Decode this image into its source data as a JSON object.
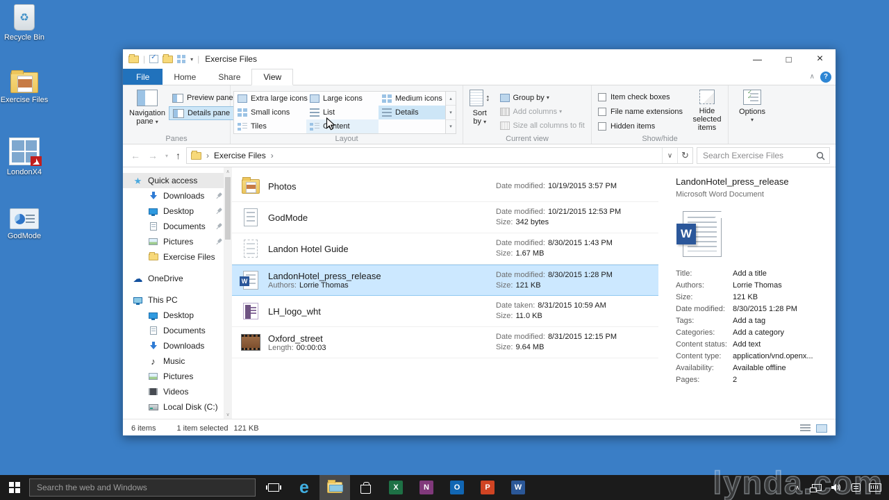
{
  "colors": {
    "desktop": "#3a7ec6",
    "accent": "#2172bc",
    "selection": "#cce8ff",
    "taskbar": "#1b1b1b"
  },
  "glyphs": {
    "minimize": "—",
    "maximize": "□",
    "close": "×",
    "back": "←",
    "forward": "→",
    "up": "↑",
    "refresh": "↻",
    "dropdown": "▾",
    "collapse": "∧",
    "help": "?",
    "crumb_sep": "›",
    "scroll_up": "▴",
    "scroll_down": "▾",
    "star": "★",
    "cloud": "☁",
    "music_note": "♪",
    "recycle": "♻",
    "updown": "↕",
    "chevron_down": "∨",
    "chevron_up": "∧"
  },
  "desktop_icons": [
    {
      "label": "Recycle Bin"
    },
    {
      "label": "Exercise Files"
    },
    {
      "label": "LondonX4"
    },
    {
      "label": "GodMode"
    }
  ],
  "watermark": "lynda.com",
  "titlebar": {
    "title": "Exercise Files"
  },
  "tabs": {
    "file": "File",
    "home": "Home",
    "share": "Share",
    "view": "View"
  },
  "ribbon": {
    "panes": {
      "group_label": "Panes",
      "navigation_pane_line1": "Navigation",
      "navigation_pane_line2": "pane",
      "preview_pane": "Preview pane",
      "details_pane": "Details pane"
    },
    "layout": {
      "group_label": "Layout",
      "extra_large": "Extra large icons",
      "small": "Small icons",
      "tiles": "Tiles",
      "large": "Large icons",
      "list": "List",
      "content": "Content",
      "medium": "Medium icons",
      "details": "Details"
    },
    "current_view": {
      "group_label": "Current view",
      "sort_by_line1": "Sort",
      "sort_by_line2": "by",
      "group_by": "Group by",
      "add_columns": "Add columns",
      "size_all": "Size all columns to fit"
    },
    "show_hide": {
      "group_label": "Show/hide",
      "item_check_boxes": "Item check boxes",
      "file_name_extensions": "File name extensions",
      "hidden_items": "Hidden items",
      "hide_selected_line1": "Hide selected",
      "hide_selected_line2": "items"
    },
    "options": {
      "label": "Options"
    }
  },
  "addressbar": {
    "crumb": "Exercise Files",
    "search_placeholder": "Search Exercise Files"
  },
  "sidebar": {
    "items": [
      {
        "label": "Quick access"
      },
      {
        "label": "Downloads"
      },
      {
        "label": "Desktop"
      },
      {
        "label": "Documents"
      },
      {
        "label": "Pictures"
      },
      {
        "label": "Exercise Files"
      },
      {
        "label": "OneDrive"
      },
      {
        "label": "This PC"
      },
      {
        "label": "Desktop"
      },
      {
        "label": "Documents"
      },
      {
        "label": "Downloads"
      },
      {
        "label": "Music"
      },
      {
        "label": "Pictures"
      },
      {
        "label": "Videos"
      },
      {
        "label": "Local Disk (C:)"
      }
    ]
  },
  "files": [
    {
      "name": "Photos",
      "meta1_label": "Date modified:",
      "meta1_value": "10/19/2015 3:57 PM"
    },
    {
      "name": "GodMode",
      "meta1_label": "Date modified:",
      "meta1_value": "10/21/2015 12:53 PM",
      "meta2_label": "Size:",
      "meta2_value": "342 bytes"
    },
    {
      "name": "Landon Hotel Guide",
      "meta1_label": "Date modified:",
      "meta1_value": "8/30/2015 1:43 PM",
      "meta2_label": "Size:",
      "meta2_value": "1.67 MB"
    },
    {
      "name": "LandonHotel_press_release",
      "sub_label": "Authors:",
      "sub_value": "Lorrie  Thomas",
      "meta1_label": "Date modified:",
      "meta1_value": "8/30/2015 1:28 PM",
      "meta2_label": "Size:",
      "meta2_value": "121 KB"
    },
    {
      "name": "LH_logo_wht",
      "meta1_label": "Date taken:",
      "meta1_value": "8/31/2015 10:59 AM",
      "meta2_label": "Size:",
      "meta2_value": "11.0 KB"
    },
    {
      "name": "Oxford_street",
      "sub_label": "Length:",
      "sub_value": "00:00:03",
      "meta1_label": "Date modified:",
      "meta1_value": "8/31/2015 12:15 PM",
      "meta2_label": "Size:",
      "meta2_value": "9.64 MB"
    }
  ],
  "details": {
    "title": "LandonHotel_press_release",
    "type": "Microsoft Word Document",
    "props": [
      {
        "label": "Title:",
        "value": "Add a title"
      },
      {
        "label": "Authors:",
        "value": "Lorrie  Thomas"
      },
      {
        "label": "Size:",
        "value": "121 KB"
      },
      {
        "label": "Date modified:",
        "value": "8/30/2015 1:28 PM"
      },
      {
        "label": "Tags:",
        "value": "Add a tag"
      },
      {
        "label": "Categories:",
        "value": "Add a category"
      },
      {
        "label": "Content status:",
        "value": "Add text"
      },
      {
        "label": "Content type:",
        "value": "application/vnd.openx..."
      },
      {
        "label": "Availability:",
        "value": "Available offline"
      },
      {
        "label": "Pages:",
        "value": "2"
      }
    ]
  },
  "statusbar": {
    "items": "6 items",
    "selected": "1 item selected",
    "size": "121 KB"
  },
  "taskbar": {
    "search_placeholder": "Search the web and Windows"
  }
}
